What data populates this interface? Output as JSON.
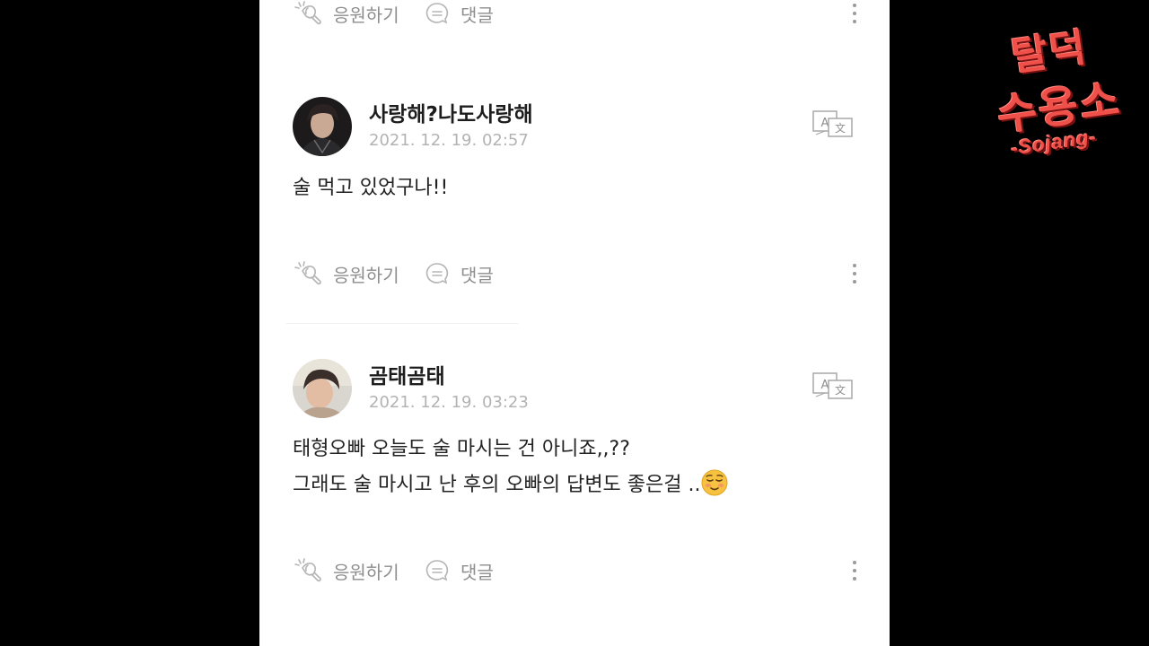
{
  "actions": {
    "cheer_label": "응원하기",
    "comment_label": "댓글"
  },
  "posts": [
    {
      "username": "사랑해?나도사랑해",
      "timestamp": "2021. 12. 19. 02:57",
      "body_lines": [
        "술 먹고 있었구나!!"
      ]
    },
    {
      "username": "곰태곰태",
      "timestamp": "2021. 12. 19. 03:23",
      "body_lines": [
        "태형오빠 오늘도 술 마시는 건 아니죠,,??",
        "그래도 술 마시고 난 후의 오빠의 답변도 좋은걸 .."
      ],
      "emoji": "relieved-face"
    }
  ],
  "watermark": {
    "line1": "탈덕",
    "line2": "수용소",
    "line3": "-Sojang-"
  },
  "colors": {
    "background": "#000000",
    "panel": "#ffffff",
    "muted_text": "#8e8e8e",
    "timestamp": "#b3b3b3",
    "watermark_red": "#f0504a"
  },
  "icons": [
    "cheer-icon",
    "comment-bubble-icon",
    "more-vertical-icon",
    "translate-icon"
  ]
}
